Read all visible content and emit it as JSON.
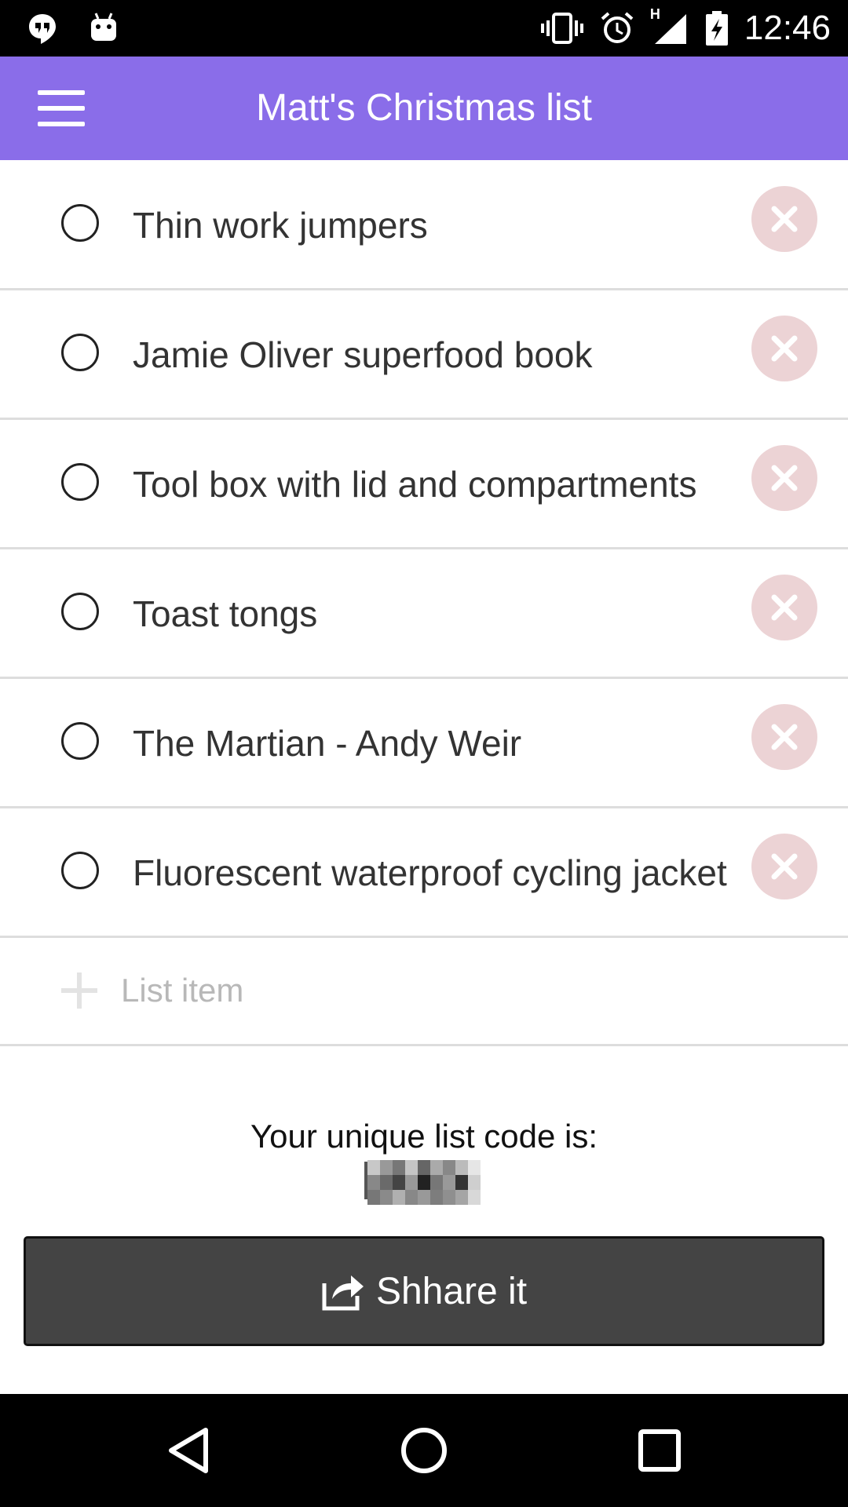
{
  "status_bar": {
    "time": "12:46",
    "icons": [
      "hangouts-icon",
      "android-icon",
      "vibrate-icon",
      "alarm-icon",
      "signal-icon",
      "battery-charging-icon"
    ],
    "network_label": "H"
  },
  "app_bar": {
    "title": "Matt's Christmas list",
    "menu_icon": "menu-icon"
  },
  "list": {
    "items": [
      {
        "label": "Thin work jumpers"
      },
      {
        "label": "Jamie Oliver superfood book"
      },
      {
        "label": "Tool box with lid and compartments"
      },
      {
        "label": "Toast tongs"
      },
      {
        "label": "The Martian - Andy Weir"
      },
      {
        "label": "Fluorescent waterproof cycling jacket"
      }
    ],
    "add_placeholder": "List item"
  },
  "code": {
    "label": "Your unique list code is:"
  },
  "share": {
    "label": "Shhare it",
    "icon": "share-icon"
  },
  "colors": {
    "app_bar": "#8a6de9",
    "delete_bg": "#ecd3d5",
    "share_bg": "#444444"
  },
  "nav_bar": {
    "icons": [
      "back-icon",
      "home-icon",
      "recents-icon"
    ]
  }
}
